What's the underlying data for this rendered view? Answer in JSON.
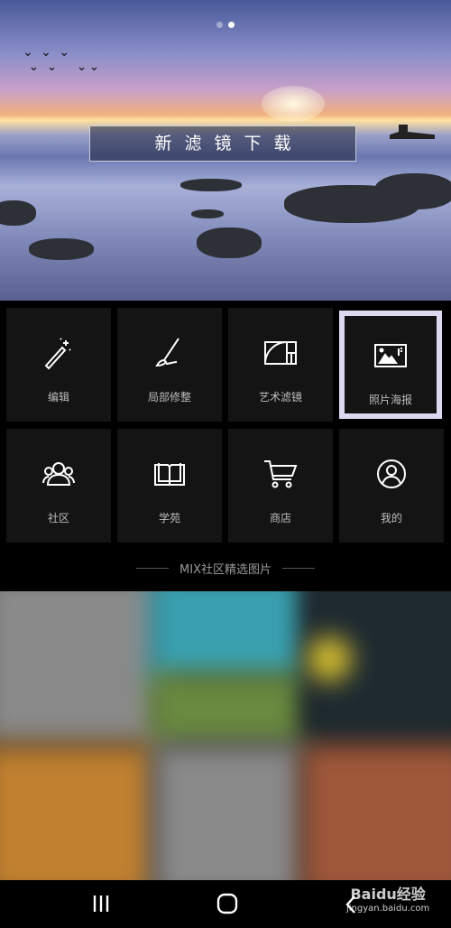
{
  "banner": {
    "button_label": "新滤镜下载",
    "page_dots": 2,
    "active_dot": 1
  },
  "grid": [
    {
      "label": "编辑",
      "icon": "magic-wand-icon"
    },
    {
      "label": "局部修整",
      "icon": "brush-icon"
    },
    {
      "label": "艺术滤镜",
      "icon": "golden-ratio-icon"
    },
    {
      "label": "照片海报",
      "icon": "photo-poster-icon",
      "selected": true
    },
    {
      "label": "社区",
      "icon": "community-icon"
    },
    {
      "label": "学苑",
      "icon": "book-icon"
    },
    {
      "label": "商店",
      "icon": "cart-icon"
    },
    {
      "label": "我的",
      "icon": "profile-icon"
    }
  ],
  "section_title": "MIX社区精选图片",
  "watermark": {
    "brand": "Baidu经验",
    "url": "jingyan.baidu.com"
  }
}
